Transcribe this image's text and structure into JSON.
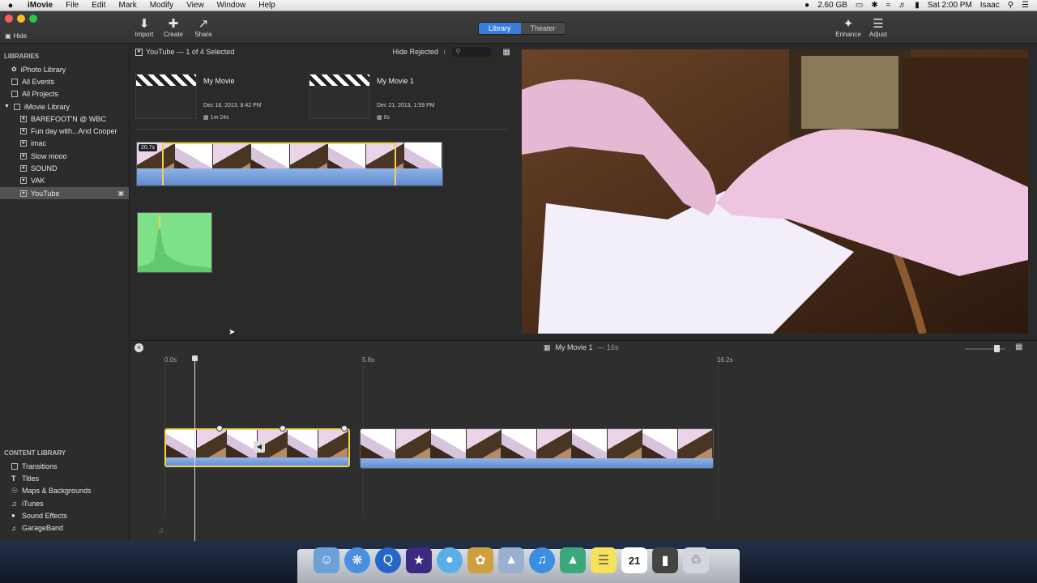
{
  "menubar": {
    "apple": "",
    "app_name": "iMovie",
    "menus": [
      "File",
      "Edit",
      "Mark",
      "Modify",
      "View",
      "Window",
      "Help"
    ],
    "disk": "2.60 GB",
    "clock": "Sat 2:00 PM",
    "user": "Isaac"
  },
  "toolbar": {
    "hide": "Hide",
    "import": "Import",
    "create": "Create",
    "share": "Share",
    "library_tab": "Library",
    "theater_tab": "Theater",
    "enhance": "Enhance",
    "adjust": "Adjust"
  },
  "sidebar": {
    "libraries_header": "LIBRARIES",
    "top_items": [
      "iPhoto Library",
      "All Events",
      "All Projects"
    ],
    "imovie_library": "iMovie Library",
    "events": [
      "BAREFOOT'N @ WBC",
      "Fun day with...And Cooper",
      "imac",
      "Slow mooo",
      "SOUND",
      "VAK",
      "YouTube"
    ],
    "content_header": "CONTENT LIBRARY",
    "content_items": [
      "Transitions",
      "Titles",
      "Maps & Backgrounds",
      "iTunes",
      "Sound Effects",
      "GarageBand"
    ]
  },
  "browser": {
    "header": "YouTube — 1 of 4 Selected",
    "filter": "Hide Rejected",
    "projects": [
      {
        "name": "My Movie",
        "date": "Dec 18, 2013, 8:42 PM",
        "duration": "1m 24s"
      },
      {
        "name": "My Movie 1",
        "date": "Dec 21, 2013, 1:59 PM",
        "duration": "0s"
      }
    ],
    "clip_badge": "20.7s"
  },
  "timeline": {
    "title": "My Movie 1",
    "duration": "16s",
    "ticks": [
      "0.0s",
      "5.6s",
      "16.2s"
    ]
  },
  "colors": {
    "accent": "#3b7ddb",
    "selection": "#f2d24a",
    "audio_wave": "#6a95d8",
    "audio_green": "#7fe08a"
  }
}
